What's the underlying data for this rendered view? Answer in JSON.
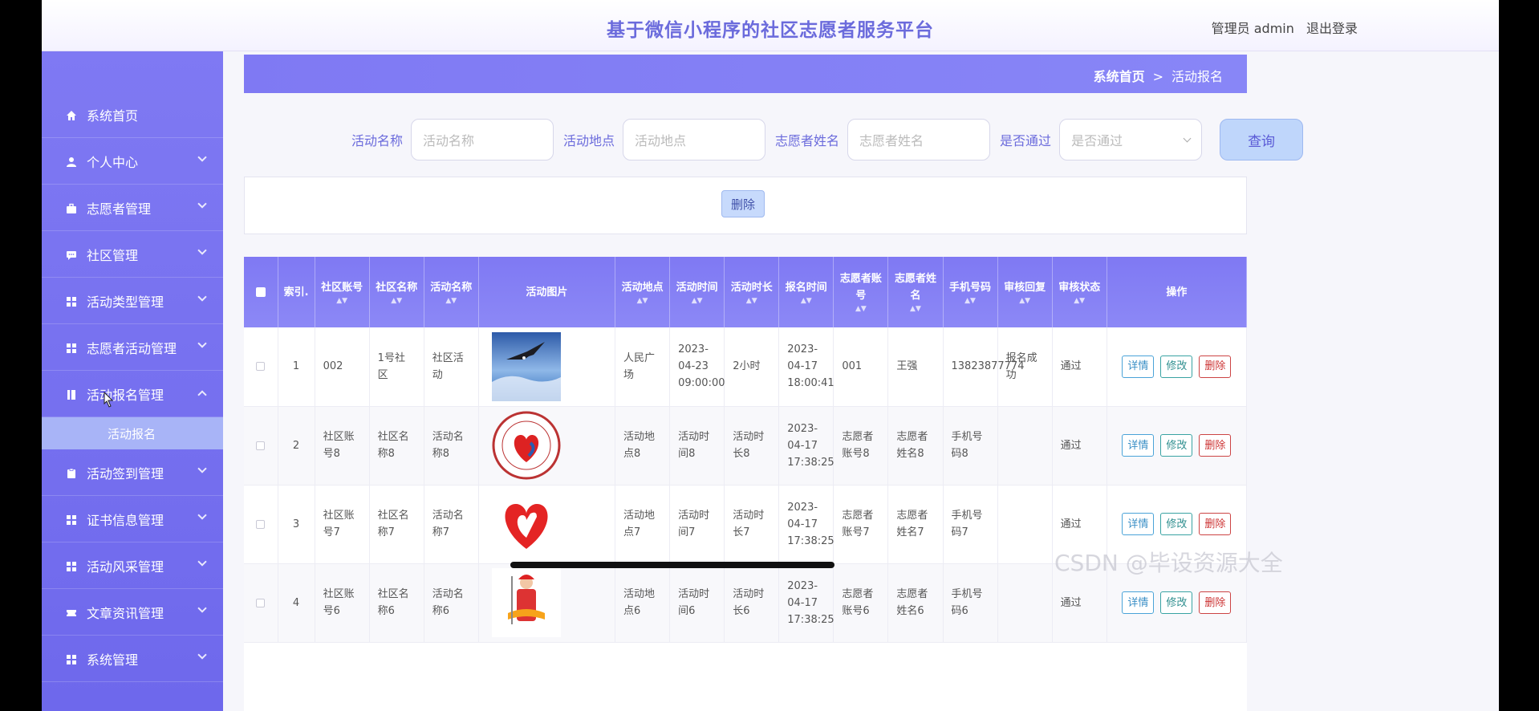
{
  "header": {
    "title": "基于微信小程序的社区志愿者服务平台",
    "user_label": "管理员 admin",
    "logout_label": "退出登录"
  },
  "sidebar": {
    "items": [
      {
        "label": "系统首页",
        "icon": "home-icon",
        "chevron": "none"
      },
      {
        "label": "个人中心",
        "icon": "user-icon",
        "chevron": "down"
      },
      {
        "label": "志愿者管理",
        "icon": "briefcase-icon",
        "chevron": "down"
      },
      {
        "label": "社区管理",
        "icon": "chat-icon",
        "chevron": "down"
      },
      {
        "label": "活动类型管理",
        "icon": "grid-icon",
        "chevron": "down"
      },
      {
        "label": "志愿者活动管理",
        "icon": "grid-icon",
        "chevron": "down"
      },
      {
        "label": "活动报名管理",
        "icon": "book-icon",
        "chevron": "up"
      },
      {
        "label": "活动签到管理",
        "icon": "clipboard-icon",
        "chevron": "down"
      },
      {
        "label": "证书信息管理",
        "icon": "grid-icon",
        "chevron": "down"
      },
      {
        "label": "活动风采管理",
        "icon": "grid-icon",
        "chevron": "down"
      },
      {
        "label": "文章资讯管理",
        "icon": "ticket-icon",
        "chevron": "down"
      },
      {
        "label": "系统管理",
        "icon": "grid-icon",
        "chevron": "down"
      }
    ],
    "submenu": {
      "label": "活动报名"
    }
  },
  "breadcrumb": {
    "home": "系统首页",
    "separator": ">",
    "current": "活动报名"
  },
  "search": {
    "activity_name_label": "活动名称",
    "activity_name_placeholder": "活动名称",
    "activity_location_label": "活动地点",
    "activity_location_placeholder": "活动地点",
    "volunteer_name_label": "志愿者姓名",
    "volunteer_name_placeholder": "志愿者姓名",
    "approved_label": "是否通过",
    "approved_placeholder": "是否通过",
    "query_button": "查询"
  },
  "actions": {
    "delete_button": "删除"
  },
  "table": {
    "headers": {
      "index": "索引.",
      "community_account": "社区账号",
      "community_name": "社区名称",
      "activity_name": "活动名称",
      "activity_image": "活动图片",
      "activity_location": "活动地点",
      "activity_time": "活动时间",
      "activity_duration": "活动时长",
      "signup_time": "报名时间",
      "volunteer_account": "志愿者账号",
      "volunteer_name": "志愿者姓名",
      "phone": "手机号码",
      "review_reply": "审核回复",
      "review_status": "审核状态",
      "operations": "操作"
    },
    "rows": [
      {
        "index": "1",
        "community_account": "002",
        "community_name": "1号社区",
        "activity_name": "社区活动",
        "image": "eagle-photo",
        "activity_location": "人民广场",
        "activity_time": "2023-04-23 09:00:00",
        "activity_duration": "2小时",
        "signup_time": "2023-04-17 18:00:41",
        "volunteer_account": "001",
        "volunteer_name": "王强",
        "phone": "13823877774",
        "review_reply": "报名成功",
        "review_status": "通过"
      },
      {
        "index": "2",
        "community_account": "社区账号8",
        "community_name": "社区名称8",
        "activity_name": "活动名称8",
        "image": "volunteer-badge",
        "activity_location": "活动地点8",
        "activity_time": "活动时间8",
        "activity_duration": "活动时长8",
        "signup_time": "2023-04-17 17:38:25",
        "volunteer_account": "志愿者账号8",
        "volunteer_name": "志愿者姓名8",
        "phone": "手机号码8",
        "review_reply": "",
        "review_status": "通过"
      },
      {
        "index": "3",
        "community_account": "社区账号7",
        "community_name": "社区名称7",
        "activity_name": "活动名称7",
        "image": "heart-hand-logo",
        "activity_location": "活动地点7",
        "activity_time": "活动时间7",
        "activity_duration": "活动时长7",
        "signup_time": "2023-04-17 17:38:25",
        "volunteer_account": "志愿者账号7",
        "volunteer_name": "志愿者姓名7",
        "phone": "手机号码7",
        "review_reply": "",
        "review_status": "通过"
      },
      {
        "index": "4",
        "community_account": "社区账号6",
        "community_name": "社区名称6",
        "activity_name": "活动名称6",
        "image": "volunteer-figure",
        "activity_location": "活动地点6",
        "activity_time": "活动时间6",
        "activity_duration": "活动时长6",
        "signup_time": "2023-04-17 17:38:25",
        "volunteer_account": "志愿者账号6",
        "volunteer_name": "志愿者姓名6",
        "phone": "手机号码6",
        "review_reply": "",
        "review_status": "通过"
      }
    ],
    "row_actions": {
      "detail": "详情",
      "edit": "修改",
      "delete": "删除"
    }
  },
  "watermark": "CSDN @毕设资源大全",
  "colors": {
    "accent": "#7f79f3",
    "title": "#6b6bdc",
    "detail": "#3b8fc6",
    "edit": "#2f8f8f",
    "danger": "#cc3333"
  }
}
